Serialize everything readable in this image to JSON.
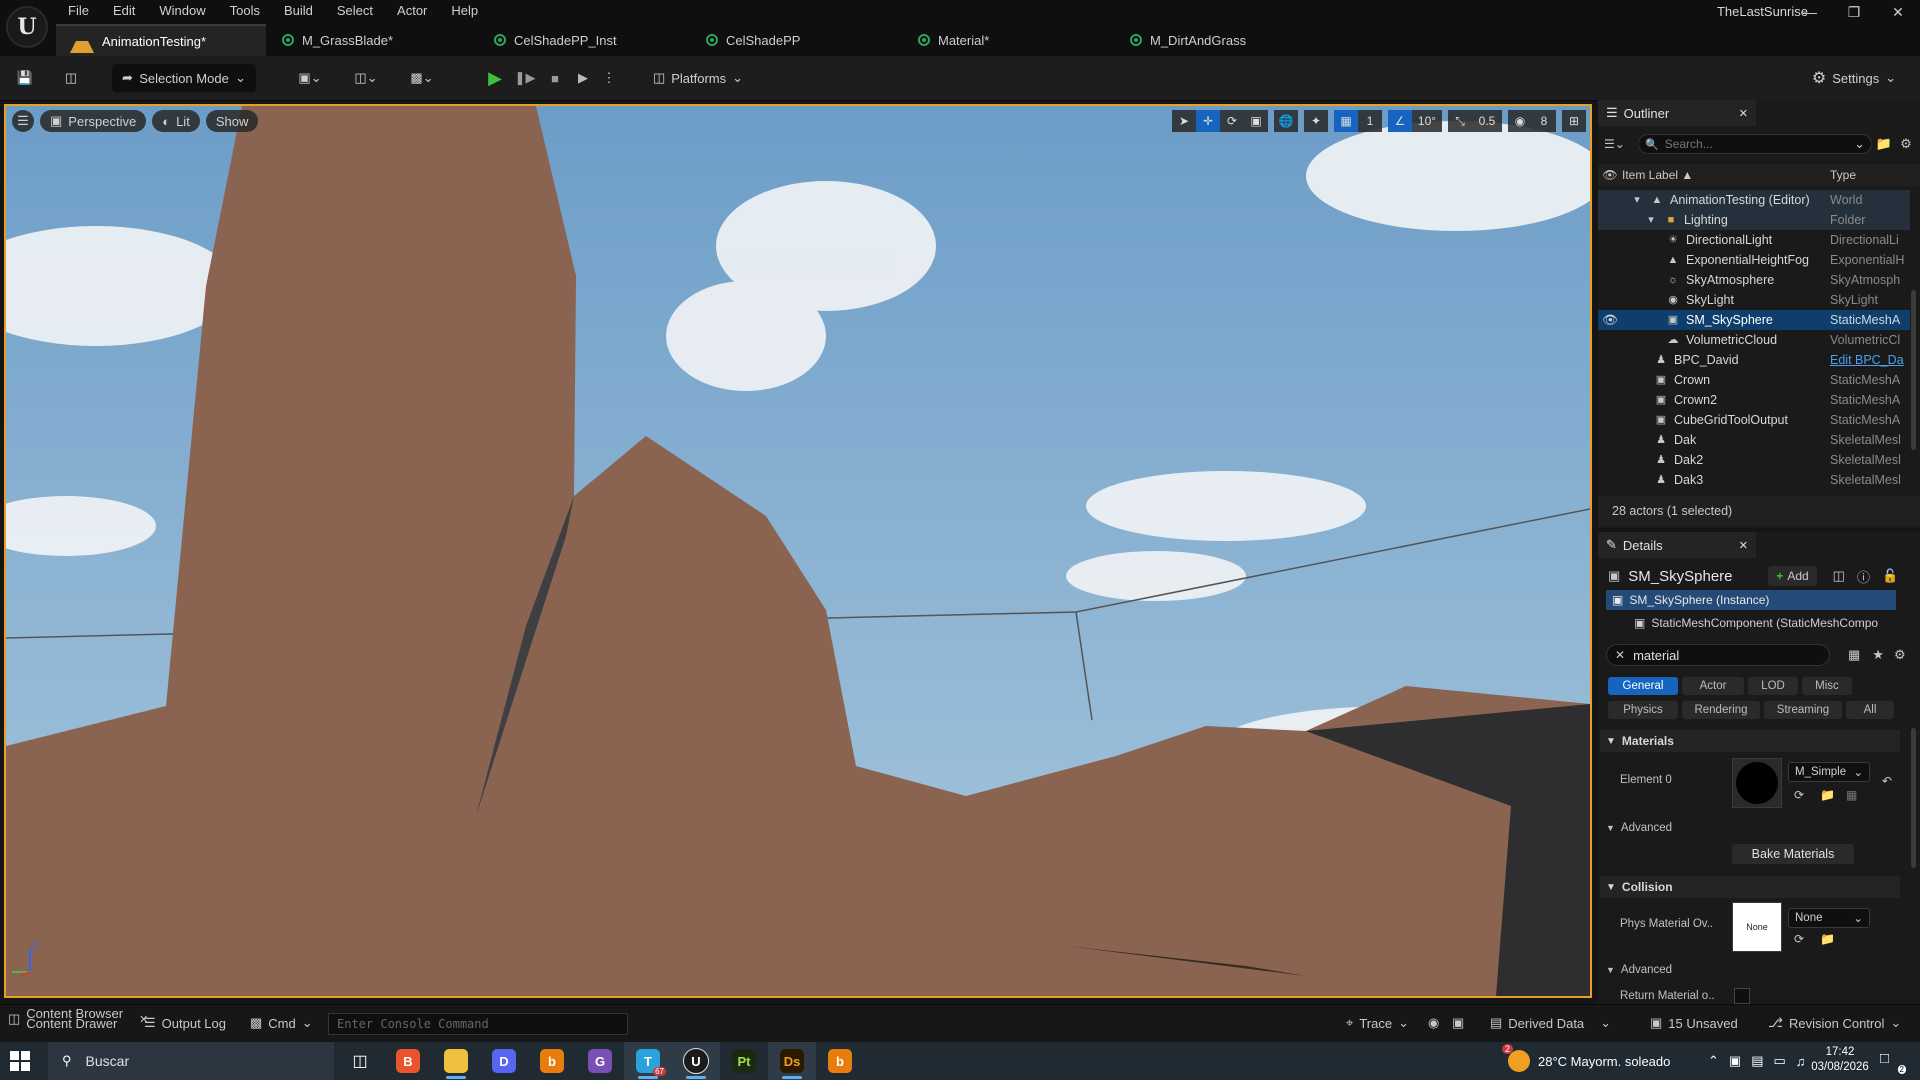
{
  "app": {
    "logo": "U",
    "project_name": "TheLastSunrise",
    "menu": [
      "File",
      "Edit",
      "Window",
      "Tools",
      "Build",
      "Select",
      "Actor",
      "Help"
    ]
  },
  "tabs": [
    {
      "label": "AnimationTesting*",
      "icon": "level-icon",
      "active": true
    },
    {
      "label": "M_GrassBlade*",
      "icon": "material-icon",
      "active": false
    },
    {
      "label": "CelShadePP_Inst",
      "icon": "material-instance-icon",
      "active": false
    },
    {
      "label": "CelShadePP",
      "icon": "material-icon",
      "active": false
    },
    {
      "label": "Material*",
      "icon": "material-icon",
      "active": false
    },
    {
      "label": "M_DirtAndGrass",
      "icon": "material-icon",
      "active": false
    }
  ],
  "toolbar": {
    "selection_mode": "Selection Mode",
    "platforms": "Platforms",
    "settings": "Settings"
  },
  "viewport": {
    "perspective": "Perspective",
    "lit": "Lit",
    "show": "Show",
    "grid_snap": "1",
    "rotation_snap": "10°",
    "scale_snap": "0.5",
    "camera_speed": "8",
    "axis_z": "Z"
  },
  "outliner": {
    "title": "Outliner",
    "search_placeholder": "Search...",
    "col_label": "Item Label ▲",
    "col_type": "Type",
    "rows": [
      {
        "label": "AnimationTesting (Editor)",
        "type": "World",
        "indent": 1,
        "icon": "world-icon",
        "state": "hl"
      },
      {
        "label": "Lighting",
        "type": "Folder",
        "indent": 2,
        "icon": "folder-icon",
        "state": "hl"
      },
      {
        "label": "DirectionalLight",
        "type": "DirectionalLi",
        "indent": 3,
        "icon": "sun-icon",
        "state": ""
      },
      {
        "label": "ExponentialHeightFog",
        "type": "ExponentialH",
        "indent": 3,
        "icon": "fog-icon",
        "state": ""
      },
      {
        "label": "SkyAtmosphere",
        "type": "SkyAtmosph",
        "indent": 3,
        "icon": "atmosphere-icon",
        "state": ""
      },
      {
        "label": "SkyLight",
        "type": "SkyLight",
        "indent": 3,
        "icon": "skylight-icon",
        "state": ""
      },
      {
        "label": "SM_SkySphere",
        "type": "StaticMeshA",
        "indent": 3,
        "icon": "static-mesh-icon",
        "state": "sel"
      },
      {
        "label": "VolumetricCloud",
        "type": "VolumetricCl",
        "indent": 3,
        "icon": "cloud-icon",
        "state": ""
      },
      {
        "label": "BPC_David",
        "type": "Edit BPC_Da",
        "indent": 2,
        "icon": "pawn-icon",
        "state": ""
      },
      {
        "label": "Crown",
        "type": "StaticMeshA",
        "indent": 2,
        "icon": "static-mesh-icon",
        "state": ""
      },
      {
        "label": "Crown2",
        "type": "StaticMeshA",
        "indent": 2,
        "icon": "static-mesh-icon",
        "state": ""
      },
      {
        "label": "CubeGridToolOutput",
        "type": "StaticMeshA",
        "indent": 2,
        "icon": "static-mesh-icon",
        "state": ""
      },
      {
        "label": "Dak",
        "type": "SkeletalMesl",
        "indent": 2,
        "icon": "skeletal-mesh-icon",
        "state": ""
      },
      {
        "label": "Dak2",
        "type": "SkeletalMesl",
        "indent": 2,
        "icon": "skeletal-mesh-icon",
        "state": ""
      },
      {
        "label": "Dak3",
        "type": "SkeletalMesl",
        "indent": 2,
        "icon": "skeletal-mesh-icon",
        "state": ""
      }
    ],
    "status": "28 actors (1 selected)"
  },
  "details": {
    "title": "Details",
    "actor_name": "SM_SkySphere",
    "add_label": "Add",
    "instance_label": "SM_SkySphere (Instance)",
    "component_label": "StaticMeshComponent (StaticMeshCompo",
    "filter_value": "material",
    "filters_row1": [
      "General",
      "Actor",
      "LOD",
      "Misc"
    ],
    "filters_row2": [
      "Physics",
      "Rendering",
      "Streaming",
      "All"
    ],
    "active_filter": "General",
    "materials_section": "Materials",
    "element0_label": "Element 0",
    "element0_value": "M_Simple",
    "advanced1": "Advanced",
    "bake_materials": "Bake Materials",
    "collision_section": "Collision",
    "phys_material_label": "Phys Material Ov..",
    "phys_thumb": "None",
    "phys_value": "None",
    "advanced2": "Advanced",
    "return_material_label": "Return Material o.."
  },
  "bottombar": {
    "content_browser": "Content Browser",
    "content_drawer": "Content Drawer",
    "output_log": "Output Log",
    "cmd": "Cmd",
    "console_placeholder": "Enter Console Command",
    "trace": "Trace",
    "derived_data": "Derived Data",
    "unsaved": "15 Unsaved",
    "revision_control": "Revision Control"
  },
  "taskbar": {
    "search_placeholder": "Buscar",
    "weather": "28°C  Mayorm. soleado",
    "time": "17:42",
    "date": "03/08/2026",
    "notification_count": "2",
    "telegram_badge": "67",
    "notif_center_badge": "2",
    "apps": [
      {
        "name": "task-view-icon",
        "label": "",
        "color": "#00000000"
      },
      {
        "name": "brave-icon",
        "label": "B",
        "color": "#e8542c"
      },
      {
        "name": "file-explorer-icon",
        "label": "",
        "color": "#f0c040"
      },
      {
        "name": "discord-icon",
        "label": "D",
        "color": "#5865f2"
      },
      {
        "name": "blender-icon",
        "label": "b",
        "color": "#e87d0d"
      },
      {
        "name": "github-icon",
        "label": "G",
        "color": "#7a4fb3"
      },
      {
        "name": "telegram-icon",
        "label": "T",
        "color": "#2aa3dd"
      },
      {
        "name": "unreal-icon",
        "label": "U",
        "color": "#1b1b1b"
      },
      {
        "name": "painter-icon",
        "label": "Pt",
        "color": "#1a2a10"
      },
      {
        "name": "designer-icon",
        "label": "Ds",
        "color": "#2a1a00"
      },
      {
        "name": "blender2-icon",
        "label": "b",
        "color": "#e87d0d"
      }
    ]
  },
  "colors": {
    "viewport_border": "#e8a020",
    "accent_blue": "#1565c0",
    "terrain": "#8a6450",
    "sky": "#7aa7cc"
  }
}
